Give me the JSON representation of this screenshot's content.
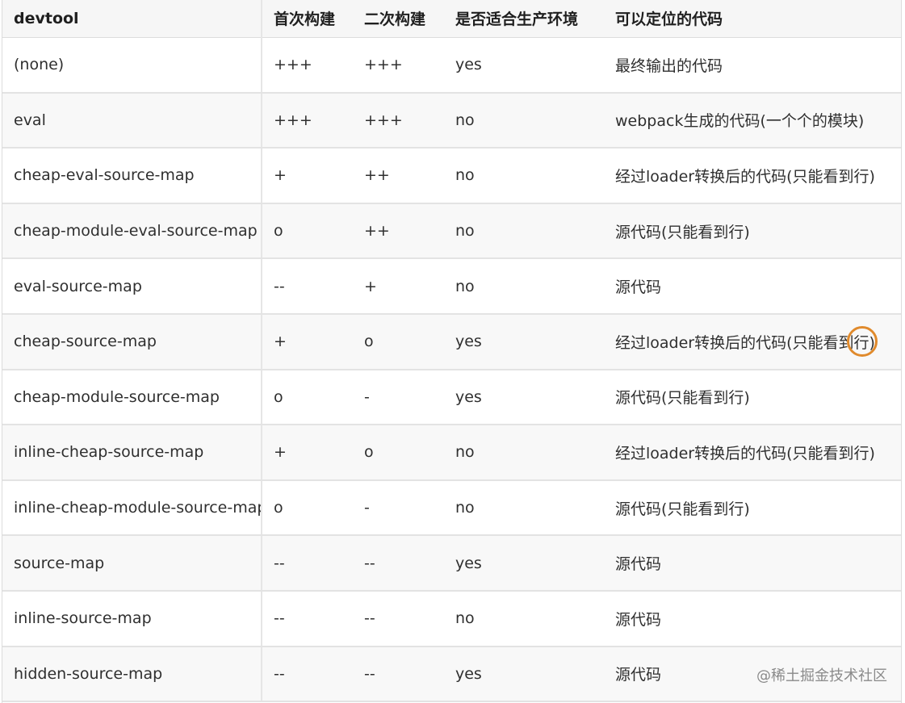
{
  "columns": [
    "devtool",
    "首次构建",
    "二次构建",
    "是否适合生产环境",
    "可以定位的代码"
  ],
  "rows": [
    [
      "(none)",
      "+++",
      "+++",
      "yes",
      "最终输出的代码"
    ],
    [
      "eval",
      "+++",
      "+++",
      "no",
      "webpack生成的代码(一个个的模块)"
    ],
    [
      "cheap-eval-source-map",
      "+",
      "++",
      "no",
      "经过loader转换后的代码(只能看到行)"
    ],
    [
      "cheap-module-eval-source-map",
      "o",
      "++",
      "no",
      "源代码(只能看到行)"
    ],
    [
      "eval-source-map",
      "--",
      "+",
      "no",
      "源代码"
    ],
    [
      "cheap-source-map",
      "+",
      "o",
      "yes",
      "经过loader转换后的代码(只能看到行)"
    ],
    [
      "cheap-module-source-map",
      "o",
      "-",
      "yes",
      "源代码(只能看到行)"
    ],
    [
      "inline-cheap-source-map",
      "+",
      "o",
      "no",
      "经过loader转换后的代码(只能看到行)"
    ],
    [
      "inline-cheap-module-source-map",
      "o",
      "-",
      "no",
      "源代码(只能看到行)"
    ],
    [
      "source-map",
      "--",
      "--",
      "yes",
      "源代码"
    ],
    [
      "inline-source-map",
      "--",
      "--",
      "no",
      "源代码"
    ],
    [
      "hidden-source-map",
      "--",
      "--",
      "yes",
      "源代码"
    ]
  ],
  "watermark": "@稀土掘金技术社区"
}
